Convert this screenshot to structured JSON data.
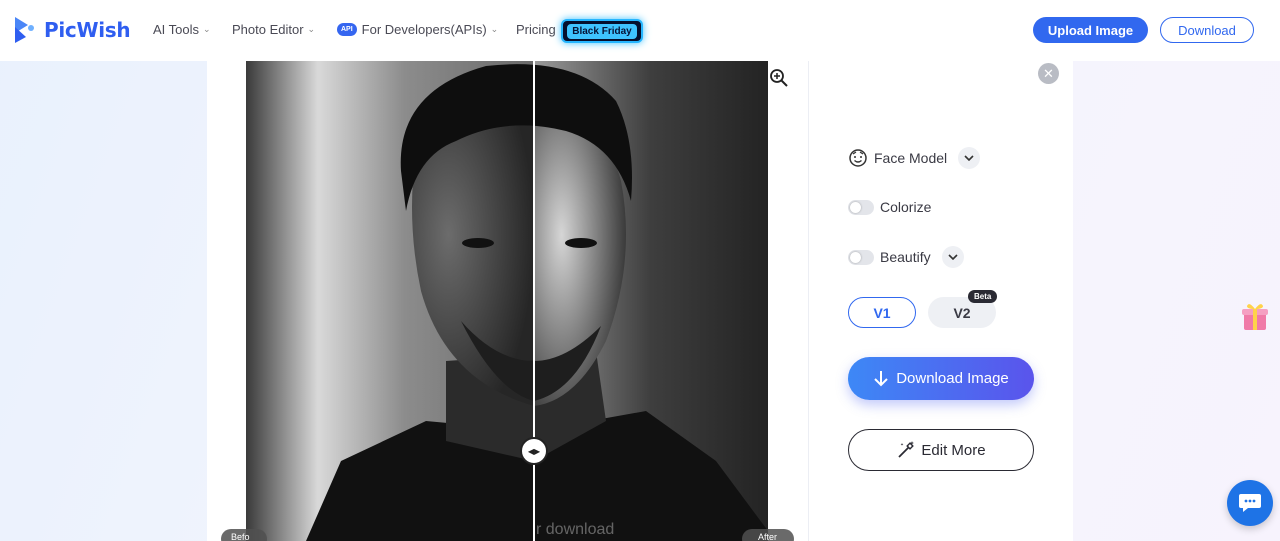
{
  "brand": {
    "name": "PicWish",
    "accent": "#3168ef"
  },
  "nav": [
    {
      "label": "AI Tools",
      "has_menu": true
    },
    {
      "label": "Photo Editor",
      "has_menu": true
    },
    {
      "label": "For Developers(APIs)",
      "badge": "API",
      "has_menu": true
    },
    {
      "label": "Pricing",
      "has_menu": false
    }
  ],
  "promo_badge": "Black Friday",
  "header_actions": {
    "upload": "Upload Image",
    "download": "Download"
  },
  "preview": {
    "watermark": "r download",
    "before_tag": "Befo",
    "after_tag": "After",
    "icons": {
      "zoom": "zoom-in-icon",
      "compare": "compare-arrows-icon"
    }
  },
  "options": {
    "face_model": "Face Model",
    "colorize": "Colorize",
    "beautify": "Beautify",
    "versions": [
      "V1",
      "V2"
    ],
    "selected_version": "V1",
    "beta_label": "Beta"
  },
  "actions": {
    "download_image": "Download Image",
    "edit_more": "Edit More"
  }
}
